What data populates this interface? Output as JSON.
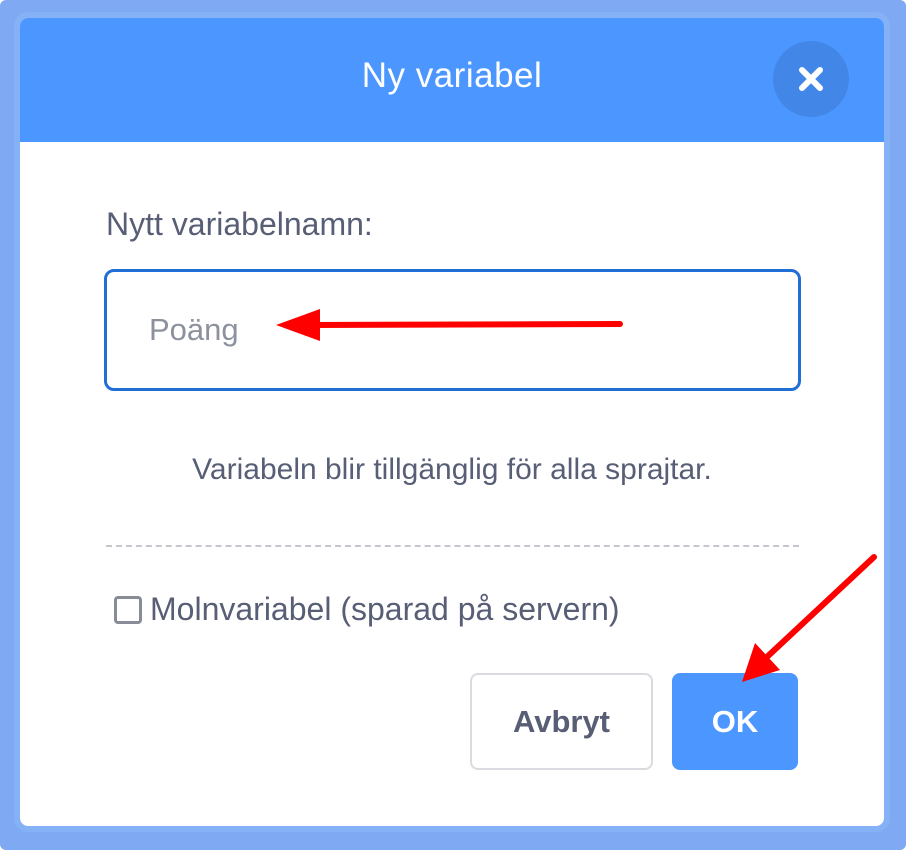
{
  "dialog": {
    "title": "Ny variabel",
    "close_icon": "close-icon",
    "name_label": "Nytt variabelnamn:",
    "name_input": {
      "value": "",
      "placeholder": "Poäng"
    },
    "scope_info": "Variabeln blir tillgänglig för alla sprajtar.",
    "cloud_checkbox": {
      "label": "Molnvariabel (sparad på servern)",
      "checked": false
    },
    "buttons": {
      "cancel_label": "Avbryt",
      "ok_label": "OK"
    }
  },
  "annotations": {
    "arrow_color": "#ff0000",
    "arrows": [
      "arrow-to-name-input",
      "arrow-to-ok-button"
    ]
  },
  "colors": {
    "header": "#4c97ff",
    "frame": "#7faaf3",
    "text": "#575e75",
    "input_border": "#1f6fd6"
  }
}
